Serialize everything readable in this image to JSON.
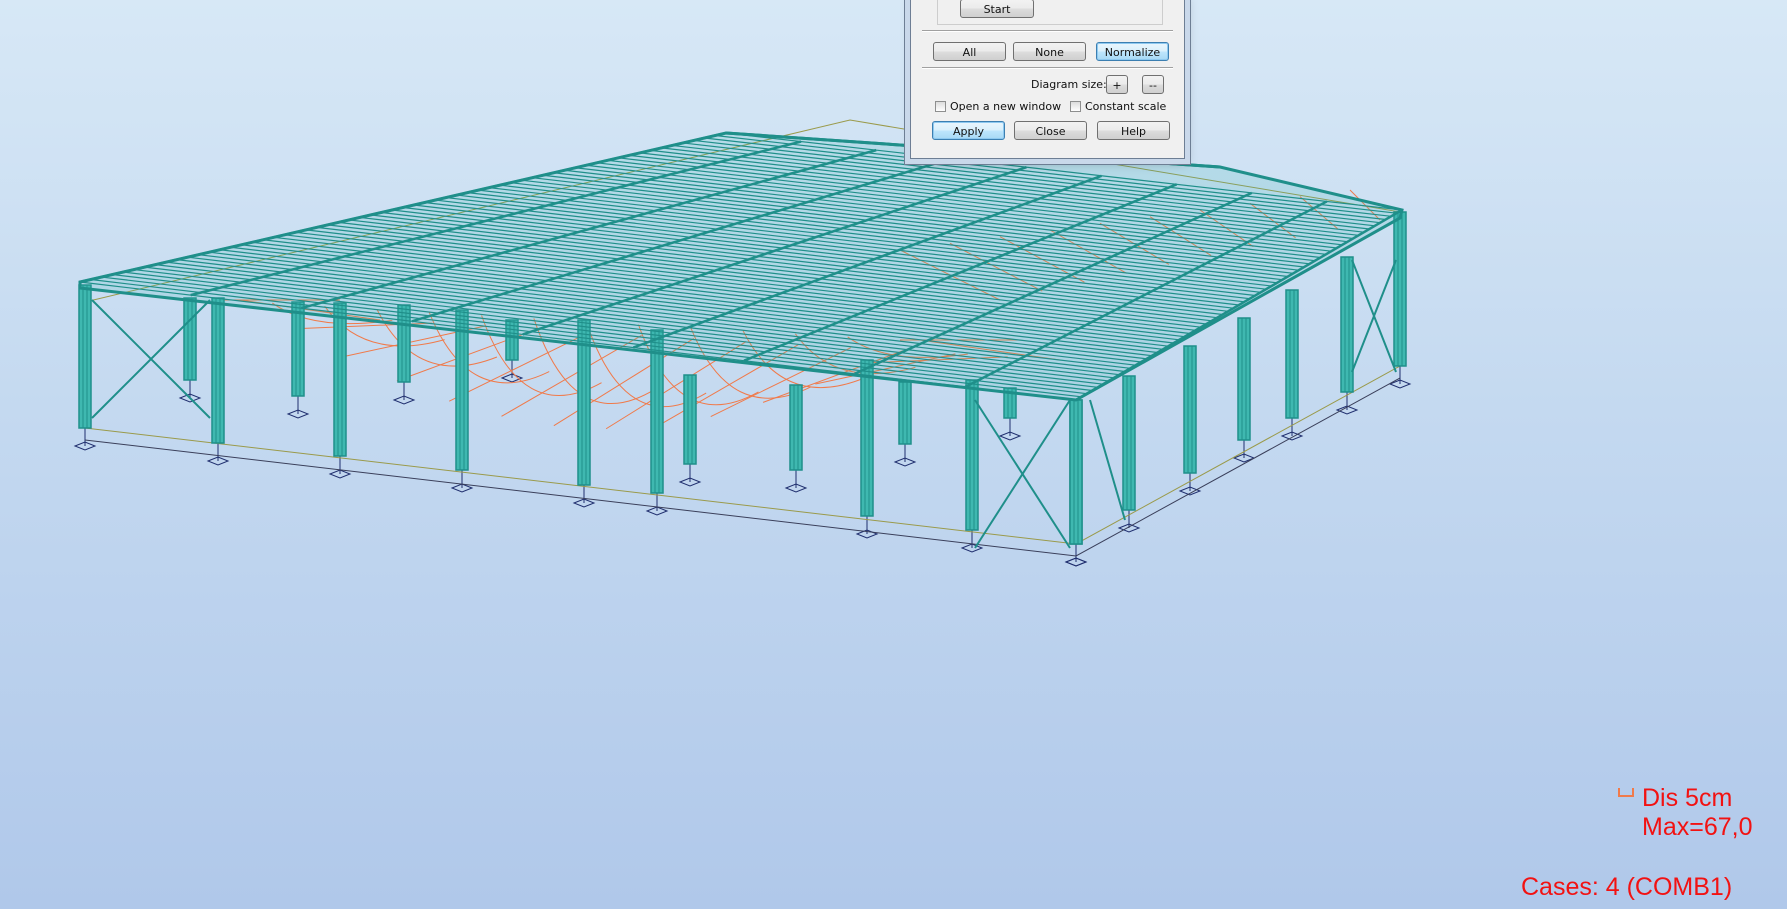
{
  "dialog": {
    "start_label": "Start",
    "all_label": "All",
    "none_label": "None",
    "normalize_label": "Normalize",
    "diagram_size_label": "Diagram size:",
    "plus_label": "+",
    "minus_label": "--",
    "open_new_window_label": "Open a new window",
    "constant_scale_label": "Constant scale",
    "apply_label": "Apply",
    "close_label": "Close",
    "help_label": "Help"
  },
  "legend": {
    "dis_label": "Dis  5cm",
    "max_label": "Max=67,0",
    "cases_label": "Cases: 4 (COMB1)"
  },
  "colors": {
    "structure": "#1f8f8a",
    "structure_light": "#3fb8b0",
    "deformed": "#f07a4a",
    "supports": "#1f2e6e",
    "legend_text": "#f21212"
  }
}
